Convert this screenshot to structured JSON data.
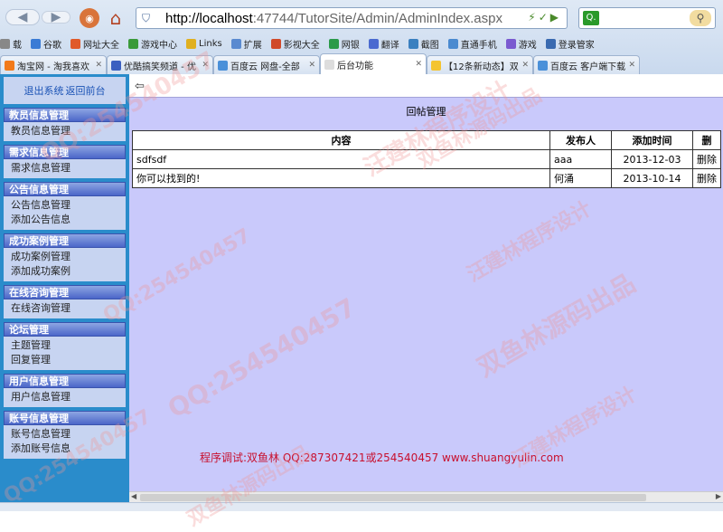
{
  "browser": {
    "url_host": "http://localhost",
    "url_rest": ":47744/TutorSite/Admin/AdminIndex.aspx",
    "favorites": [
      "载",
      "谷歌",
      "网址大全",
      "游戏中心",
      "Links",
      "扩展",
      "影视大全",
      "网银",
      "翻译",
      "截图",
      "直通手机",
      "游戏",
      "登录管家"
    ],
    "tabs": [
      {
        "title": "淘宝网 - 淘我喜欢",
        "icon_color": "#f27a1a"
      },
      {
        "title": "优酷搞笑频道 - 优",
        "icon_color": "#3a5fc0"
      },
      {
        "title": "百度云 网盘-全部",
        "icon_color": "#4a90d9"
      },
      {
        "title": "后台功能",
        "icon_color": "#dddddd",
        "active": true
      },
      {
        "title": "【12条新动态】双",
        "icon_color": "#f4c430"
      },
      {
        "title": "百度云 客户端下载",
        "icon_color": "#4a90d9"
      }
    ]
  },
  "sidebar": {
    "logout": "退出系统",
    "back": "返回前台",
    "groups": [
      {
        "title": "教员信息管理",
        "items": [
          "教员信息管理"
        ]
      },
      {
        "title": "需求信息管理",
        "items": [
          "需求信息管理"
        ]
      },
      {
        "title": "公告信息管理",
        "items": [
          "公告信息管理",
          "添加公告信息"
        ]
      },
      {
        "title": "成功案例管理",
        "items": [
          "成功案例管理",
          "添加成功案例"
        ]
      },
      {
        "title": "在线咨询管理",
        "items": [
          "在线咨询管理"
        ]
      },
      {
        "title": "论坛管理",
        "items": [
          "主题管理",
          "回复管理"
        ]
      },
      {
        "title": "用户信息管理",
        "items": [
          "用户信息管理"
        ]
      },
      {
        "title": "账号信息管理",
        "items": [
          "账号信息管理",
          "添加账号信息"
        ]
      }
    ]
  },
  "main": {
    "title": "回帖管理",
    "columns": [
      "内容",
      "发布人",
      "添加时间",
      "删"
    ],
    "rows": [
      [
        "sdfsdf",
        "aaa",
        "2013-12-03",
        "删除"
      ],
      [
        "你可以找到的!",
        "何涌",
        "2013-10-14",
        "删除"
      ]
    ],
    "footer": "程序调试:双鱼林 QQ:287307421或254540457 www.shuangyulin.com"
  },
  "watermarks": [
    "QQ:254540457",
    "汪建林程序设计",
    "双鱼林源码出品",
    "QQ:254540457",
    "汪建林程序设计",
    "双鱼林源码出品",
    "QQ:254540457",
    "汪建林程序设计",
    "QQ:254540457",
    "双鱼林源码出品"
  ]
}
